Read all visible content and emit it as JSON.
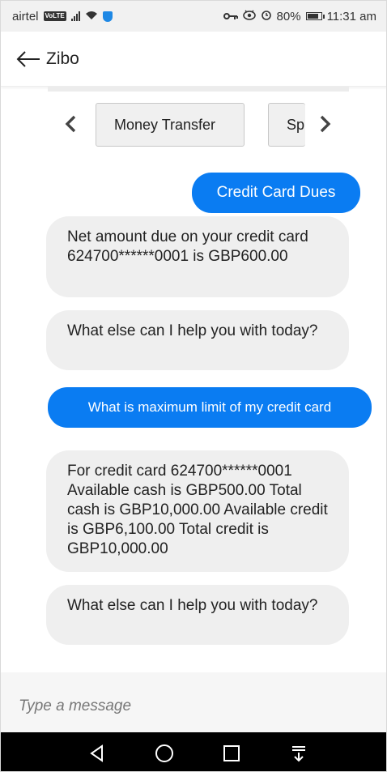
{
  "status_bar": {
    "carrier": "airtel",
    "volte": "VoLTE",
    "battery": "80%",
    "time": "11:31 am",
    "battery_level": 0.8
  },
  "header": {
    "title": "Zibo"
  },
  "carousel": {
    "items": [
      "Money Transfer",
      "Sp"
    ]
  },
  "messages": {
    "m1": "Credit Card Dues",
    "m2": "Net amount due on your credit card 624700******0001 is GBP600.00",
    "m3": "What else can I help you with today?",
    "m4": "What is maximum limit of my credit card",
    "m5": "For credit card 624700******0001 Available cash is GBP500.00 Total cash is GBP10,000.00 Available credit is GBP6,100.00 Total credit is GBP10,000.00",
    "m6": "What else can I help you with today?"
  },
  "composer": {
    "placeholder": "Type a message",
    "value": ""
  },
  "colors": {
    "user_bubble": "#0a7cf2",
    "bot_bubble": "#efefef",
    "nav_bar": "#000000"
  },
  "icons": {
    "back": "back-arrow-icon",
    "carousel_prev": "chevron-left-icon",
    "carousel_next": "chevron-right-icon",
    "nav_back": "triangle-back-icon",
    "nav_home": "circle-home-icon",
    "nav_recent": "square-recent-icon",
    "nav_menu": "notification-pull-icon"
  }
}
